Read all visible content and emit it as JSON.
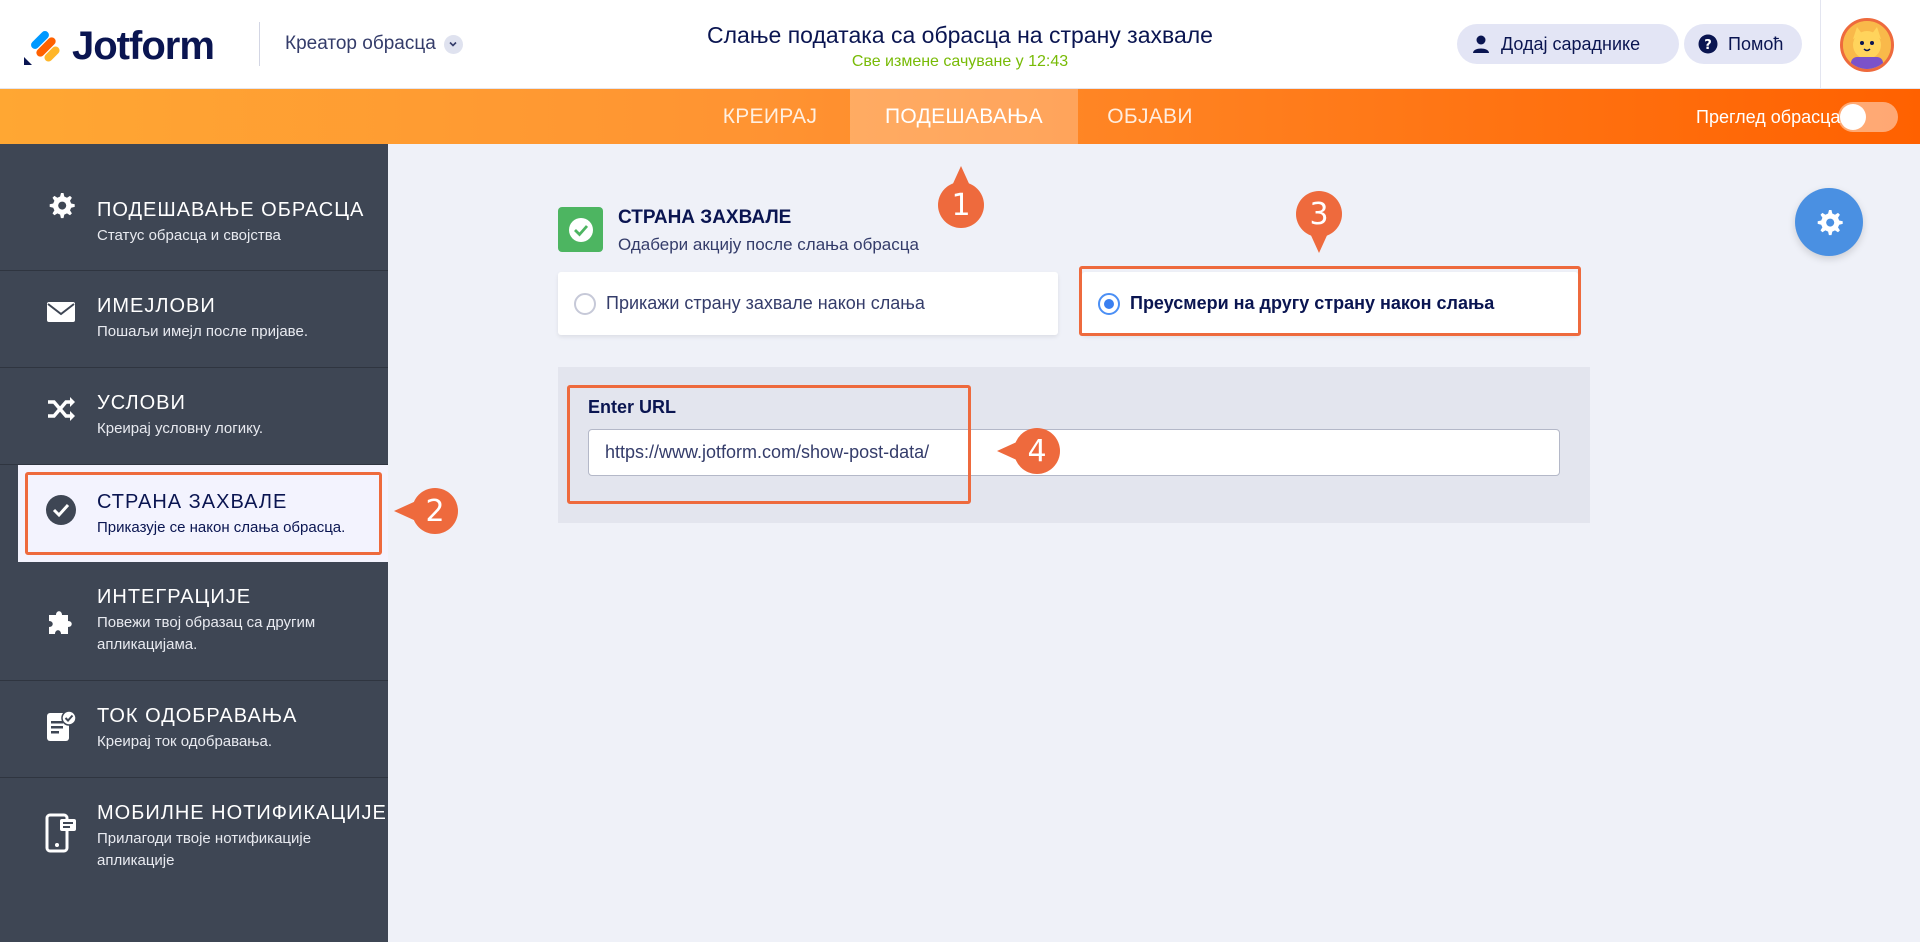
{
  "header": {
    "logo_text": "Jotform",
    "creator_label": "Креатор обрасца",
    "form_title": "Слање података са обрасца на страну захвале",
    "saved_status": "Све измене сачуване у 12:43",
    "add_collaborators": "Додај сараднике",
    "help": "Помоћ"
  },
  "nav": {
    "tabs": [
      {
        "label": "КРЕИРАЈ"
      },
      {
        "label": "ПОДЕШАВАЊА"
      },
      {
        "label": "ОБЈАВИ"
      }
    ],
    "preview_label": "Преглед обрасца",
    "preview_on": false
  },
  "sidebar": {
    "items": [
      {
        "title": "ПОДЕШАВАЊЕ ОБРАСЦА",
        "desc": "Статус обрасца и својства",
        "icon": "gear-icon"
      },
      {
        "title": "ИМЕЈЛОВИ",
        "desc": "Пошаљи имејл после пријаве.",
        "icon": "envelope-icon"
      },
      {
        "title": "УСЛОВИ",
        "desc": "Креирај условну логику.",
        "icon": "shuffle-icon"
      },
      {
        "title": "СТРАНА ЗАХВАЛЕ",
        "desc": "Приказује се након слања обрасца.",
        "icon": "check-circle-icon"
      },
      {
        "title": "ИНТЕГРАЦИЈЕ",
        "desc": "Повежи твој образац са другим апликацијама.",
        "icon": "puzzle-icon"
      },
      {
        "title": "ТОК ОДОБРАВАЊА",
        "desc": "Креирај ток одобравања.",
        "icon": "approval-icon"
      },
      {
        "title": "МОБИЛНЕ НОТИФИКАЦИЈЕ",
        "desc": "Прилагоди твоје нотификације апликације",
        "icon": "mobile-icon"
      }
    ]
  },
  "main": {
    "section_title": "СТРАНА ЗАХВАЛЕ",
    "section_subtitle": "Одабери акцију после слања обрасца",
    "option_show": "Прикажи страну захвале након слања",
    "option_redirect": "Преусмери на другу страну након слања",
    "url_label": "Enter URL",
    "url_value": "https://www.jotform.com/show-post-data/"
  },
  "annotations": {
    "badges": [
      "1",
      "2",
      "3",
      "4"
    ],
    "color": "#ee6a3d"
  },
  "colors": {
    "accent_orange": "#ff6100",
    "sidebar_bg": "#3e4654",
    "check_green": "#4db561",
    "fab_blue": "#4a90e2"
  }
}
